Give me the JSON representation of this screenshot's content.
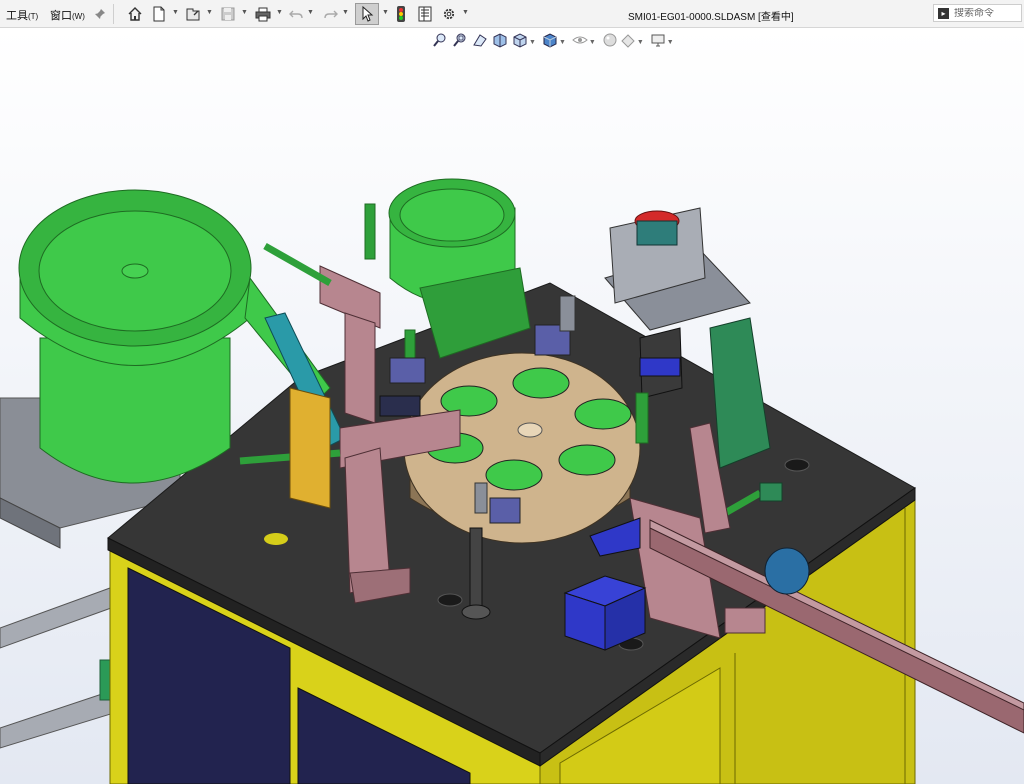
{
  "menu": [
    {
      "label": "工具",
      "key": "(T)"
    },
    {
      "label": "窗口",
      "key": "(W)"
    }
  ],
  "document_title": "SMI01-EG01-0000.SLDASM [查看中]",
  "search": {
    "placeholder": "搜索命令"
  },
  "toolbar": {
    "icons": [
      "pin-icon",
      "home-icon",
      "new-document-icon",
      "open-icon",
      "save-icon",
      "print-icon",
      "undo-icon",
      "redo-icon",
      "select-cursor-icon",
      "traffic-light-icon",
      "file-properties-icon",
      "options-gear-icon"
    ]
  },
  "heads_up_view_toolbar": {
    "icons": [
      "zoom-to-fit-icon",
      "zoom-to-area-icon",
      "previous-view-icon",
      "section-view-icon",
      "view-orientation-icon",
      "display-style-icon",
      "hide-show-items-icon",
      "edit-appearance-icon",
      "apply-scene-icon",
      "view-settings-icon"
    ]
  },
  "colors": {
    "bowl_green": "#3fc94a",
    "cabinet_yellow": "#d9d21a",
    "table_top": "#363636",
    "turntable": "#cfb48d",
    "bracket_pink": "#b7868f",
    "bin_blue": "#2f38c8"
  }
}
